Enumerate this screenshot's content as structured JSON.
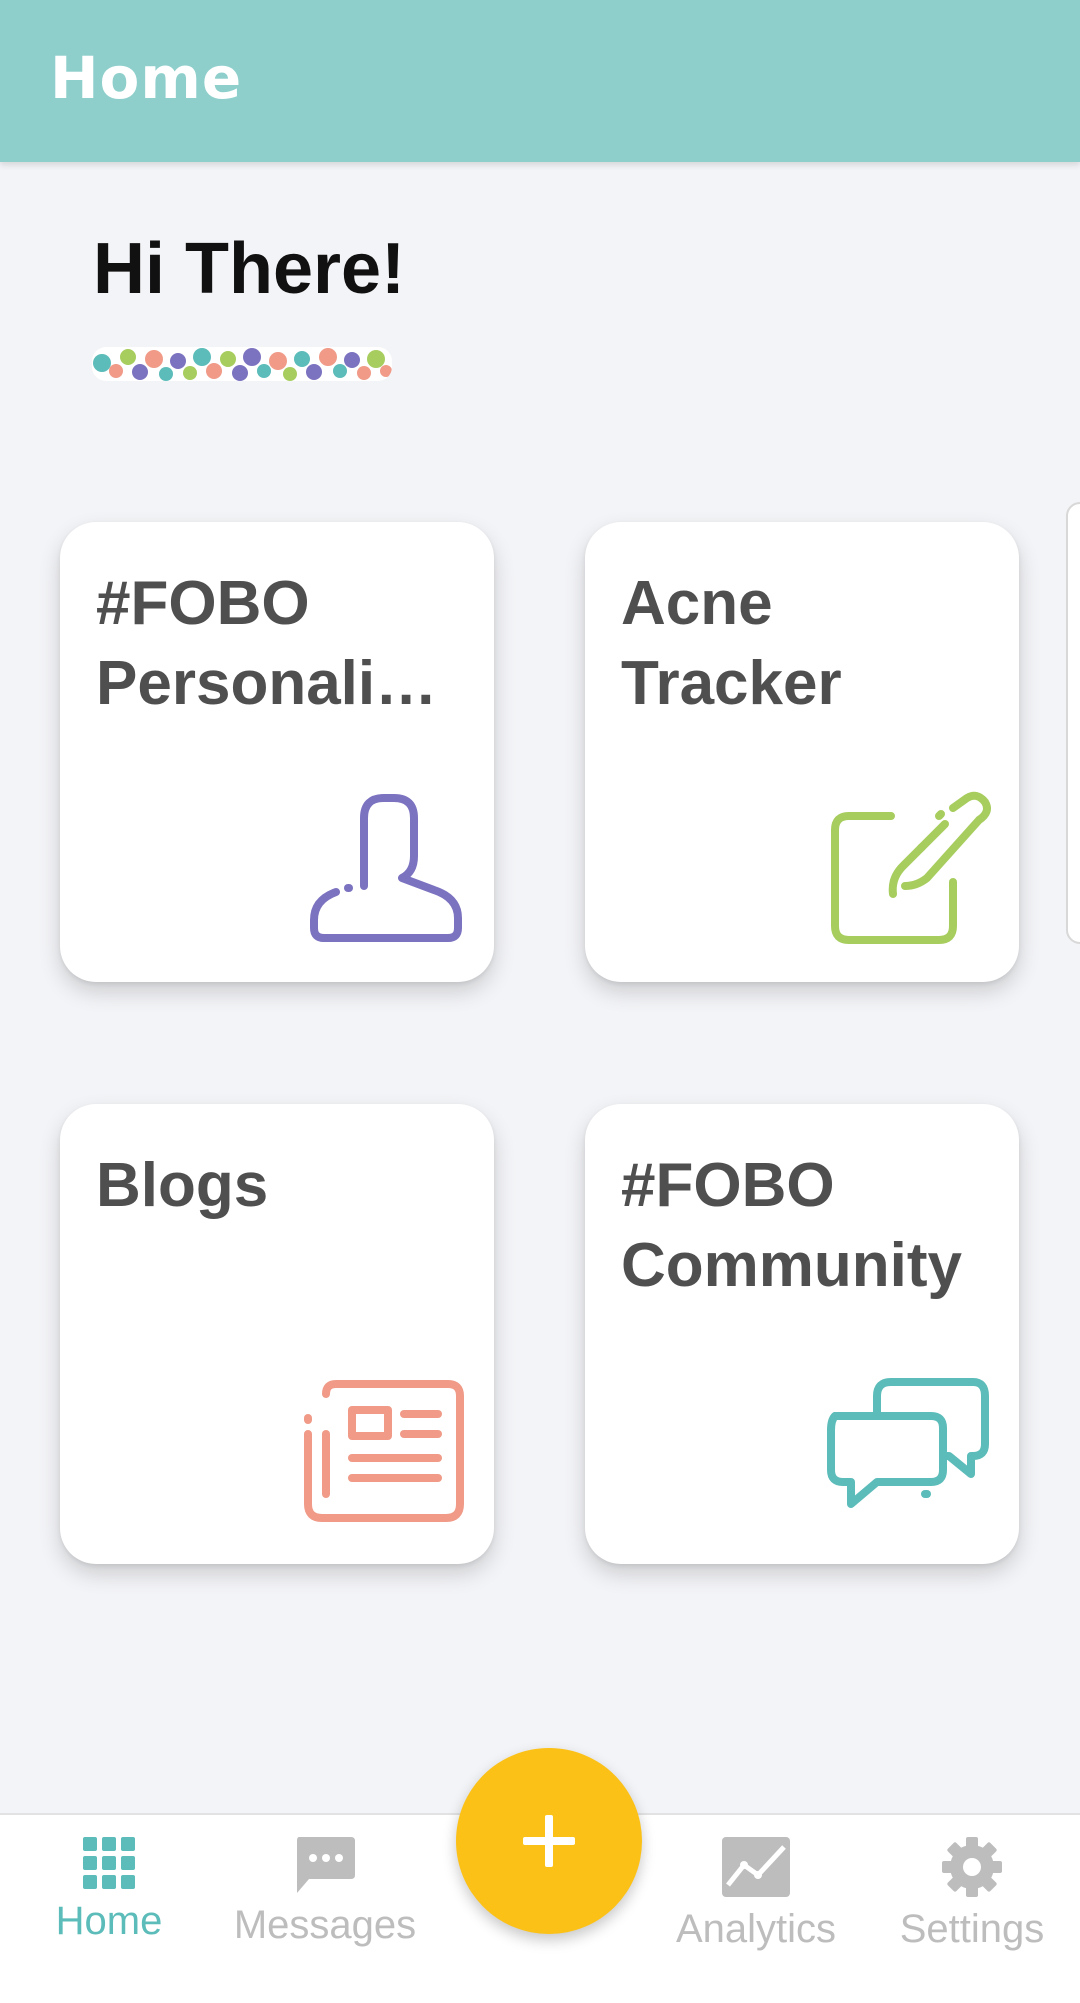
{
  "app_bar": {
    "title": "Home",
    "color": "#8ecfcc"
  },
  "greeting": {
    "text": "Hi There!"
  },
  "cards": [
    {
      "title": "#FOBO\nPersonali…",
      "icon": "person-icon",
      "color": "#7b72c0"
    },
    {
      "title": "Acne\nTracker",
      "icon": "edit-note-icon",
      "color": "#a7cd5e"
    },
    {
      "title": "Blogs",
      "icon": "newspaper-icon",
      "color": "#f09a87"
    },
    {
      "title": "#FOBO\nCommunity",
      "icon": "chat-bubbles-icon",
      "color": "#5bbcb9"
    }
  ],
  "bottom_nav": {
    "items": [
      {
        "label": "Home",
        "icon": "grid-icon",
        "active": true
      },
      {
        "label": "Messages",
        "icon": "message-icon",
        "active": false
      },
      {
        "label": "Analytics",
        "icon": "chart-icon",
        "active": false
      },
      {
        "label": "Settings",
        "icon": "gear-icon",
        "active": false
      }
    ],
    "active_color": "#5bbcb9",
    "inactive_color": "#bdbdbd"
  },
  "fab": {
    "icon": "plus-icon",
    "color": "#fcc116"
  }
}
